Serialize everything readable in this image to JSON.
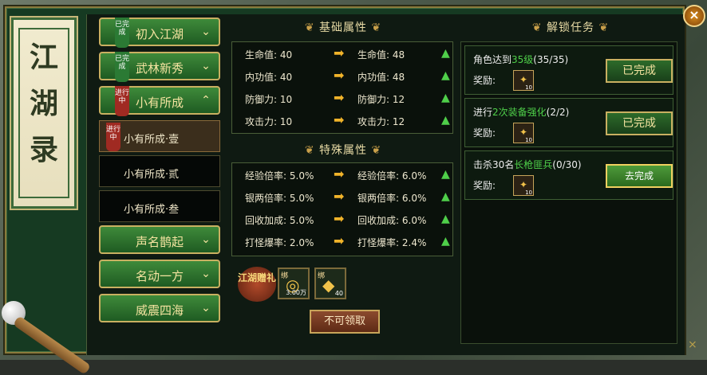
{
  "title": "江湖录",
  "nav": {
    "items": [
      {
        "label": "初入江湖",
        "badge": "已完成",
        "status": "done"
      },
      {
        "label": "武林新秀",
        "badge": "已完成",
        "status": "done"
      },
      {
        "label": "小有所成",
        "badge": "进行中",
        "status": "active",
        "chev": "^"
      }
    ],
    "sub_items": [
      {
        "label": "小有所成·壹",
        "badge": "进行中",
        "active": true
      },
      {
        "label": "小有所成·贰",
        "active": false
      },
      {
        "label": "小有所成·叁",
        "active": false
      }
    ],
    "more_items": [
      {
        "label": "声名鹊起"
      },
      {
        "label": "名动一方"
      },
      {
        "label": "威震四海"
      }
    ]
  },
  "base_attrs": {
    "title": "基础属性",
    "rows": [
      {
        "name": "生命值:",
        "from": "40",
        "to": "48"
      },
      {
        "name": "内功值:",
        "from": "40",
        "to": "48"
      },
      {
        "name": "防御力:",
        "from": "10",
        "to": "12"
      },
      {
        "name": "攻击力:",
        "from": "10",
        "to": "12"
      }
    ]
  },
  "special_attrs": {
    "title": "特殊属性",
    "rows": [
      {
        "name": "经验倍率:",
        "from": "5.0%",
        "to": "6.0%"
      },
      {
        "name": "银两倍率:",
        "from": "5.0%",
        "to": "6.0%"
      },
      {
        "name": "回收加成:",
        "from": "5.0%",
        "to": "6.0%"
      },
      {
        "name": "打怪爆率:",
        "from": "2.0%",
        "to": "2.4%"
      }
    ]
  },
  "gift": {
    "emblem": "江湖赠礼",
    "items": [
      {
        "bind": "绑",
        "qty": "3.00万",
        "icon": "gold-coins-icon"
      },
      {
        "bind": "绑",
        "qty": "40",
        "icon": "gold-ingot-icon"
      }
    ],
    "claim_label": "不可领取"
  },
  "tasks": {
    "title": "解锁任务",
    "reward_label": "奖励:",
    "list": [
      {
        "pre": "角色达到",
        "hl": "35级",
        "post": "(35/35)",
        "reward_qty": "10",
        "button": "已完成",
        "done": true
      },
      {
        "pre": "进行",
        "hl": "2次装备强化",
        "post": "(2/2)",
        "reward_qty": "10",
        "button": "已完成",
        "done": true
      },
      {
        "pre": "击杀30名",
        "hl": "长枪匪兵",
        "post": "(0/30)",
        "reward_qty": "10",
        "button": "去完成",
        "done": false
      }
    ]
  },
  "close_label": "×"
}
